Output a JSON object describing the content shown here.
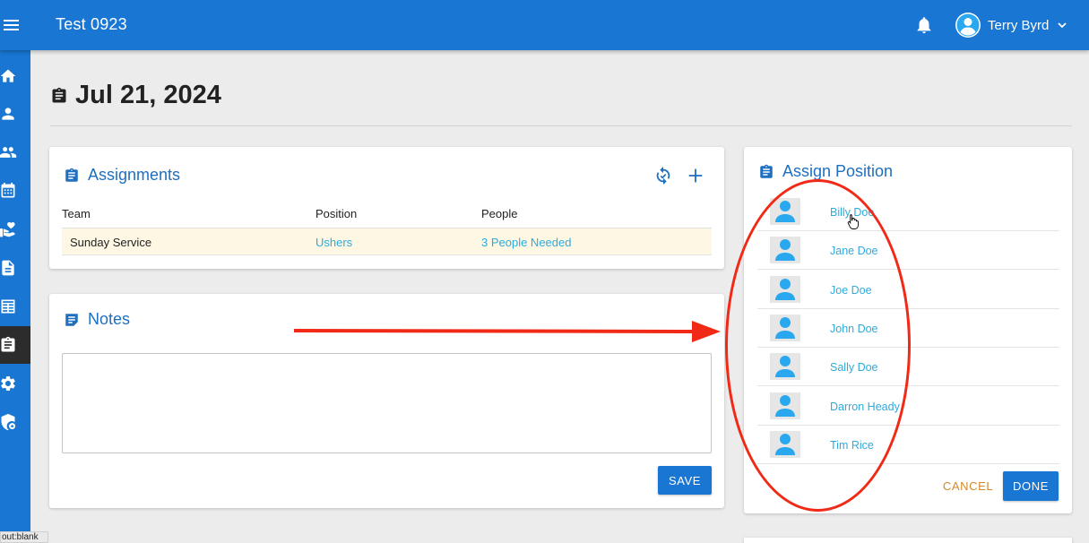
{
  "header": {
    "app_title": "Test 0923",
    "user_name": "Terry Byrd",
    "menu_icon": "hamburger-menu-icon",
    "notification_icon": "bell-icon",
    "brand_color": "#1976d2"
  },
  "sidebar": {
    "items": [
      {
        "icon": "home-icon"
      },
      {
        "icon": "person-icon"
      },
      {
        "icon": "people-icon"
      },
      {
        "icon": "calendar-icon"
      },
      {
        "icon": "donation-hand-heart-icon"
      },
      {
        "icon": "document-icon"
      },
      {
        "icon": "list-table-icon"
      },
      {
        "icon": "clipboard-icon",
        "active": true
      },
      {
        "icon": "gear-icon"
      },
      {
        "icon": "admin-shield-icon"
      }
    ]
  },
  "page": {
    "title": "Jul 21, 2024"
  },
  "assignments": {
    "title": "Assignments",
    "columns": [
      "Team",
      "Position",
      "People"
    ],
    "rows": [
      {
        "team": "Sunday Service",
        "position": "Ushers",
        "people": "3 People Needed"
      }
    ]
  },
  "notes": {
    "title": "Notes",
    "value": "",
    "save_label": "SAVE"
  },
  "assign_position": {
    "title": "Assign Position",
    "people": [
      "Billy Doe",
      "Jane Doe",
      "Joe Doe",
      "John Doe",
      "Sally Doe",
      "Darron Heady",
      "Tim Rice"
    ],
    "cancel_label": "CANCEL",
    "done_label": "DONE"
  },
  "status_tooltip": "out:blank",
  "annotation_color": "#f02a17"
}
